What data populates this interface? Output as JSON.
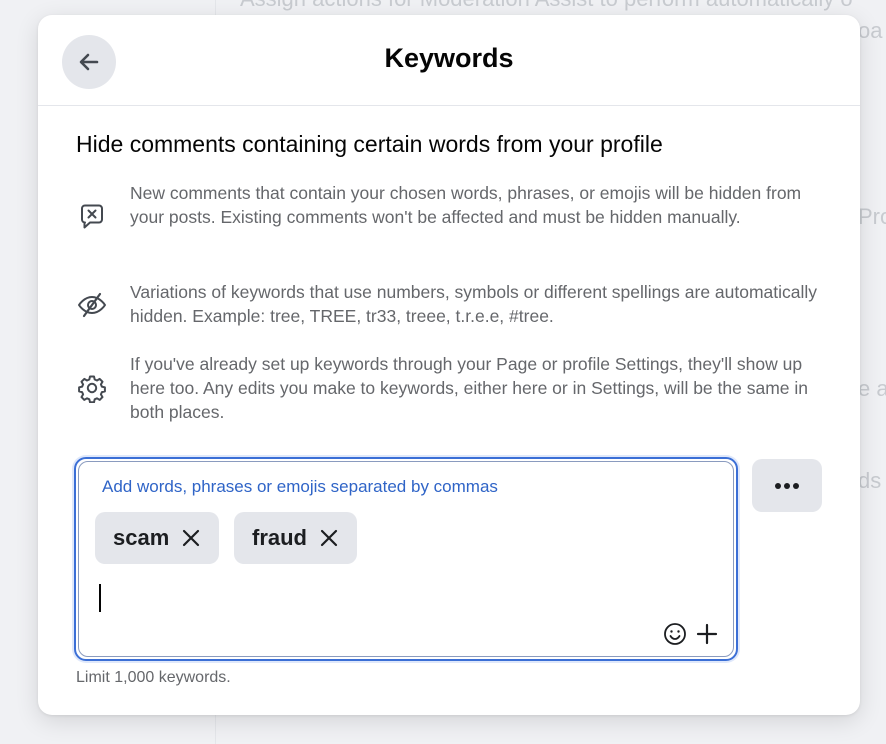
{
  "background": {
    "text_1": "Assign actions for Moderation Assist to perform automatically o",
    "text_2": "oa",
    "text_3": "Pro",
    "text_4": "e a",
    "text_5": "ds"
  },
  "dialog": {
    "title": "Keywords",
    "heading": "Hide comments containing certain words from your profile",
    "info": [
      {
        "icon": "comment-x-icon",
        "text": "New comments that contain your chosen words, phrases, or emojis will be hidden from your posts. Existing comments won't be affected and must be hidden manually."
      },
      {
        "icon": "eye-slash-icon",
        "text": "Variations of keywords that use numbers, symbols or different spellings are automatically hidden. Example: tree, TREE, tr33, treee, t.r.e.e, #tree."
      },
      {
        "icon": "gear-icon",
        "text": "If you've already set up keywords through your Page or profile Settings, they'll show up here too. Any edits you make to keywords, either here or in Settings, will be the same in both places."
      }
    ],
    "input": {
      "placeholder": "Add words, phrases or emojis separated by commas",
      "value": ""
    },
    "keywords": [
      {
        "label": "scam"
      },
      {
        "label": "fraud"
      }
    ],
    "limit_text": "Limit 1,000 keywords."
  },
  "colors": {
    "accent": "#3b6fd6",
    "chip_bg": "#e4e6eb",
    "secondary_text": "#65676b"
  }
}
